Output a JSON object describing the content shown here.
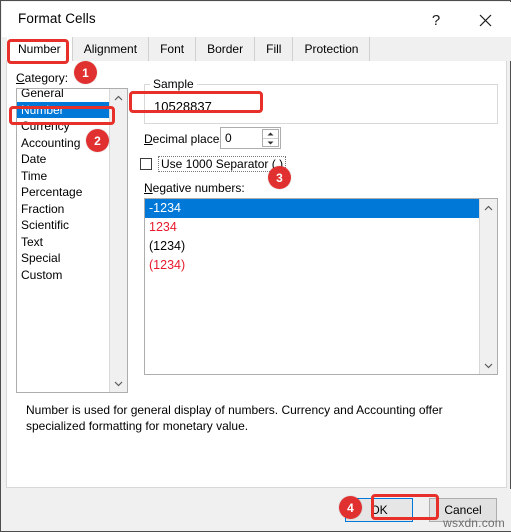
{
  "window": {
    "title": "Format Cells",
    "help_icon": "question-mark-icon",
    "close_icon": "close-icon"
  },
  "tabs": [
    {
      "label": "Number",
      "active": true
    },
    {
      "label": "Alignment",
      "active": false
    },
    {
      "label": "Font",
      "active": false
    },
    {
      "label": "Border",
      "active": false
    },
    {
      "label": "Fill",
      "active": false
    },
    {
      "label": "Protection",
      "active": false
    }
  ],
  "category": {
    "label": "Category:",
    "items": [
      {
        "text": "General",
        "selected": false
      },
      {
        "text": "Number",
        "selected": true
      },
      {
        "text": "Currency",
        "selected": false
      },
      {
        "text": "Accounting",
        "selected": false
      },
      {
        "text": "Date",
        "selected": false
      },
      {
        "text": "Time",
        "selected": false
      },
      {
        "text": "Percentage",
        "selected": false
      },
      {
        "text": "Fraction",
        "selected": false
      },
      {
        "text": "Scientific",
        "selected": false
      },
      {
        "text": "Text",
        "selected": false
      },
      {
        "text": "Special",
        "selected": false
      },
      {
        "text": "Custom",
        "selected": false
      }
    ]
  },
  "sample": {
    "legend": "Sample",
    "value": "10528837"
  },
  "decimal_places": {
    "label": "Decimal places:",
    "value": "0"
  },
  "thousand_separator": {
    "label": "Use 1000 Separator (,)",
    "checked": false
  },
  "negative_numbers": {
    "label": "Negative numbers:",
    "items": [
      {
        "text": "-1234",
        "selected": true,
        "color": "#ffffff"
      },
      {
        "text": "1234",
        "selected": false,
        "color": "#e8192c"
      },
      {
        "text": "(1234)",
        "selected": false,
        "color": "#000000"
      },
      {
        "text": "(1234)",
        "selected": false,
        "color": "#e8192c"
      }
    ]
  },
  "description": "Number is used for general display of numbers.  Currency and Accounting offer specialized formatting for monetary value.",
  "footer": {
    "ok_label": "OK",
    "cancel_label": "Cancel"
  },
  "watermark": "wsxdn.com",
  "annotations": {
    "badge_color": "#e03030",
    "outline_color": "#e8302a",
    "badges": [
      {
        "number": "1",
        "target": "number-tab"
      },
      {
        "number": "2",
        "target": "category-number-item"
      },
      {
        "number": "3",
        "target": "use-1000-separator-checkbox"
      },
      {
        "number": "4",
        "target": "ok-button"
      }
    ]
  }
}
